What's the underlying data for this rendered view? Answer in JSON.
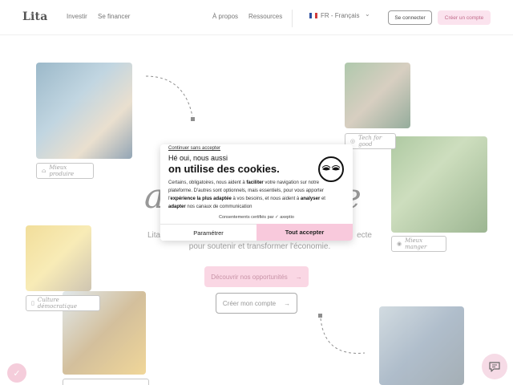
{
  "header": {
    "logo": "Lita",
    "nav": {
      "invest": "Investir",
      "finance": "Se financer",
      "about": "À propos",
      "resources": "Ressources"
    },
    "language": "FR - Français",
    "login": "Se connecter",
    "signup": "Créer un compte"
  },
  "hero": {
    "tags": {
      "tag1": "Mieux produire",
      "tag2": "Tech for good",
      "tag3": "Mieux manger",
      "tag4": "Culture démocratique",
      "tag5": ""
    },
    "title": "a",
    "title_end": "e",
    "subtitle_start": "Lita",
    "subtitle_end": "ecte",
    "subtitle_line2": "pour soutenir et transformer l'économie.",
    "cta_primary": "Découvrir nos opportunités",
    "cta_secondary": "Créer mon compte",
    "arrow": "→"
  },
  "cookie": {
    "skip": "Continuer sans accepter",
    "heading1": "Hé oui, nous aussi",
    "heading2": "on utilise des cookies.",
    "body_1": "Certains, obligatoires, nous aident à ",
    "body_b1": "faciliter",
    "body_2": " votre navigation sur notre plateforme. D'autres sont optionnels, mais essentiels, pour vous apporter l'",
    "body_b2": "expérience la plus adaptée",
    "body_3": " à vos besoins, et nous aident à ",
    "body_b3": "analyser",
    "body_4": " et ",
    "body_b4": "adapter",
    "body_5": " nos canaux de communication",
    "certified": "Consentements certifiés par ✓ axeptio",
    "btn_params": "Paramétrer",
    "btn_accept": "Tout accepter"
  },
  "colors": {
    "accent_pink": "#f8c9dc",
    "text": "#111111"
  },
  "icons": {
    "chat": "chat-icon",
    "eyes": "eyes-icon",
    "flag": "france-flag-icon"
  }
}
